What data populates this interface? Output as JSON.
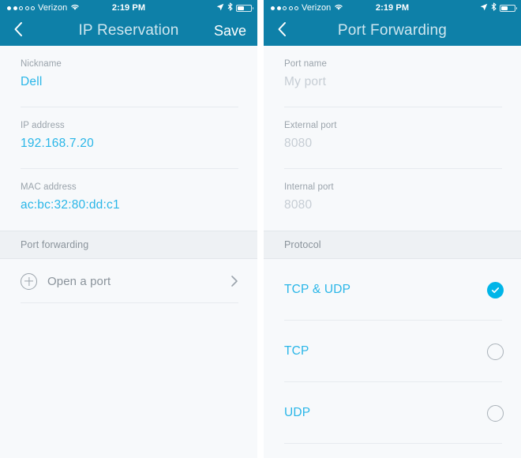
{
  "status_bar": {
    "carrier": "Verizon",
    "signal_dots_filled": 2,
    "signal_dots_total": 5,
    "wifi_icon": "wifi-icon",
    "time": "2:19 PM",
    "location_icon": "location-arrow-icon",
    "bluetooth_icon": "bluetooth-icon",
    "battery_icon": "battery-icon"
  },
  "colors": {
    "navbar_teal": "#0e80a8",
    "accent_blue": "#29b6e8",
    "check_blue": "#00b5e8",
    "background": "#f7f9fb",
    "section_band": "#eef1f4",
    "label_gray": "#9aa3ab",
    "placeholder_gray": "#c6cdd4"
  },
  "left_screen": {
    "nav": {
      "back_icon": "chevron-left-icon",
      "title": "IP Reservation",
      "action_label": "Save"
    },
    "fields": [
      {
        "label": "Nickname",
        "value": "Dell",
        "is_placeholder": false
      },
      {
        "label": "IP address",
        "value": "192.168.7.20",
        "is_placeholder": false
      },
      {
        "label": "MAC address",
        "value": "ac:bc:32:80:dd:c1",
        "is_placeholder": false
      }
    ],
    "section": {
      "title": "Port forwarding"
    },
    "action_row": {
      "icon": "plus-circle-icon",
      "label": "Open a port",
      "chevron": "chevron-right-icon"
    }
  },
  "right_screen": {
    "nav": {
      "back_icon": "chevron-left-icon",
      "title": "Port Forwarding",
      "action_label": ""
    },
    "fields": [
      {
        "label": "Port name",
        "value": "My port",
        "is_placeholder": true
      },
      {
        "label": "External port",
        "value": "8080",
        "is_placeholder": true
      },
      {
        "label": "Internal port",
        "value": "8080",
        "is_placeholder": true
      }
    ],
    "section": {
      "title": "Protocol"
    },
    "protocol_options": [
      {
        "label": "TCP & UDP",
        "selected": true
      },
      {
        "label": "TCP",
        "selected": false
      },
      {
        "label": "UDP",
        "selected": false
      }
    ]
  }
}
